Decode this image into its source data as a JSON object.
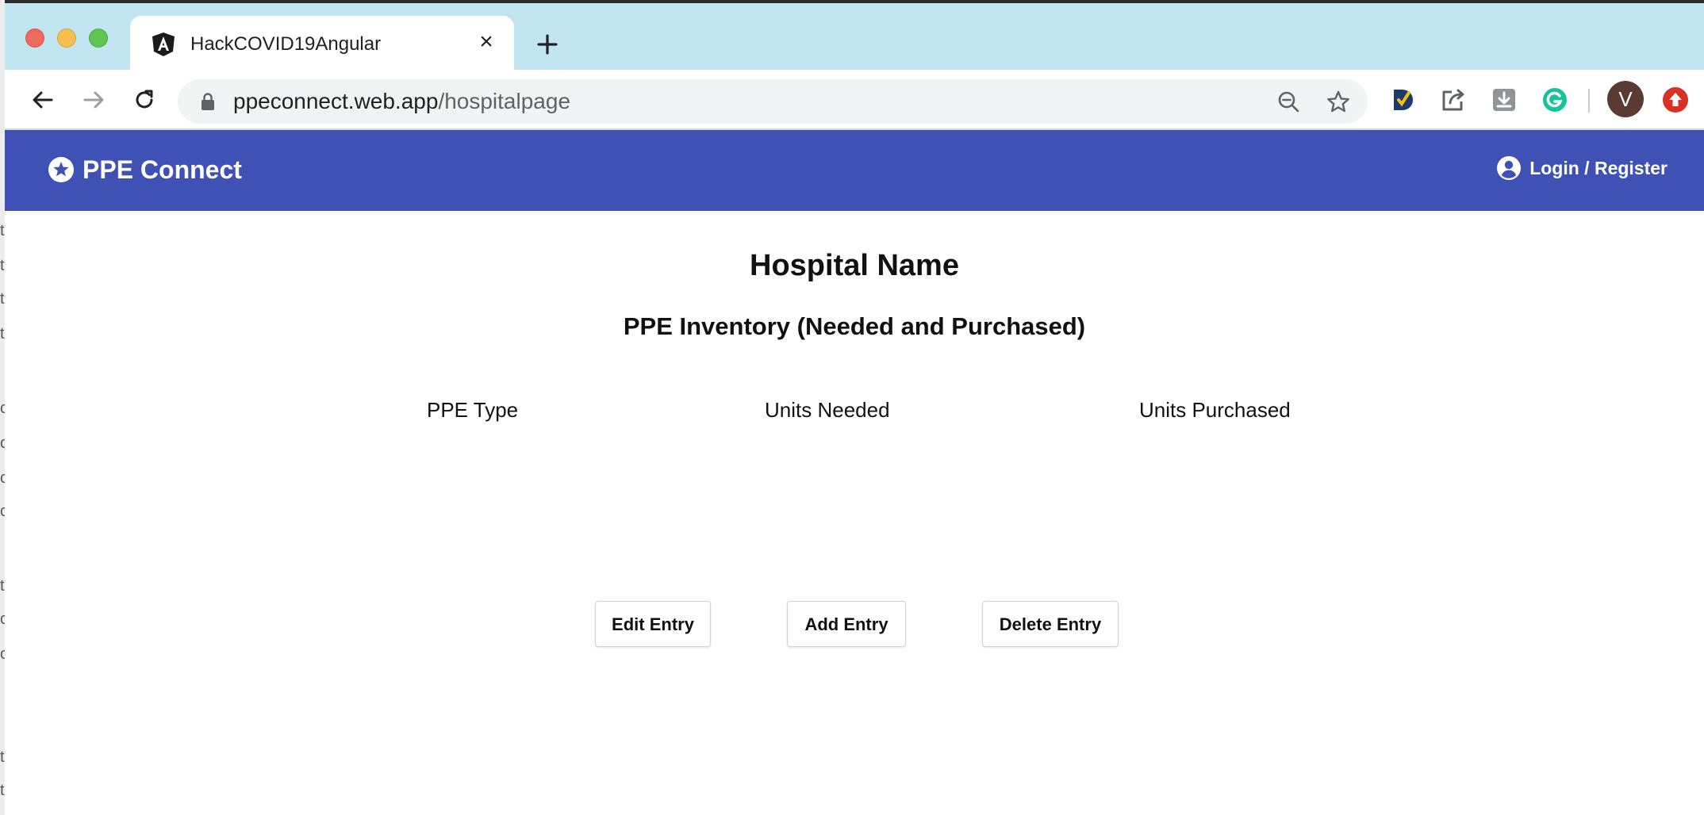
{
  "browser": {
    "tab_title": "HackCOVID19Angular",
    "url_domain": "ppeconnect.web.app",
    "url_path": "/hospitalpage",
    "avatar_letter": "V"
  },
  "app": {
    "brand": "PPE Connect",
    "login_label": "Login / Register",
    "accent": "#3f51b5"
  },
  "main": {
    "title": "Hospital Name",
    "subtitle": "PPE Inventory (Needed and Purchased)",
    "columns": [
      "PPE Type",
      "Units Needed",
      "Units Purchased"
    ],
    "buttons": {
      "edit": "Edit Entry",
      "add": "Add Entry",
      "delete": "Delete Entry"
    }
  },
  "background_fragments": [
    "t",
    "t",
    "t",
    "t",
    "c",
    "c",
    "c",
    "c",
    "t",
    "c",
    "o",
    "t",
    "t"
  ]
}
